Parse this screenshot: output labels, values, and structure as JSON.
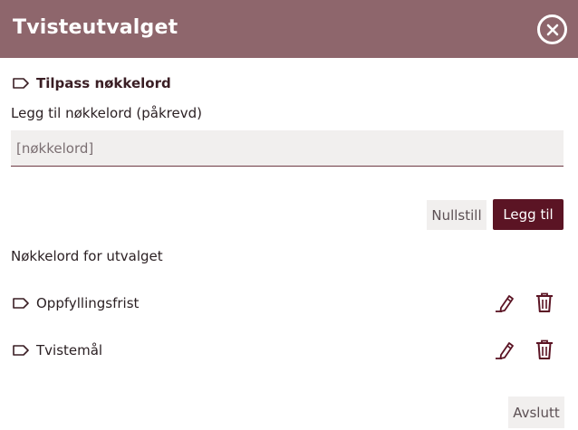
{
  "dialog": {
    "title": "Tvisteutvalget",
    "close_icon": "close-circle-icon"
  },
  "form": {
    "section_title": "Tilpass nøkkelord",
    "section_icon": "tag-icon",
    "field_label": "Legg til nøkkelord (påkrevd)",
    "input_value": "",
    "input_placeholder": "[nøkkelord]",
    "reset_label": "Nullstill",
    "add_label": "Legg til"
  },
  "keywords": {
    "heading": "Nøkkelord for utvalget",
    "items": [
      {
        "label": "Oppfyllingsfrist",
        "icon": "tag-icon",
        "edit_icon": "pencil-icon",
        "delete_icon": "trash-icon"
      },
      {
        "label": "Tvistemål",
        "icon": "tag-icon",
        "edit_icon": "pencil-icon",
        "delete_icon": "trash-icon"
      }
    ]
  },
  "footer": {
    "close_label": "Avslutt"
  },
  "colors": {
    "header_bg": "#8e666c",
    "accent": "#5b1424",
    "input_bg": "#f1efee"
  }
}
